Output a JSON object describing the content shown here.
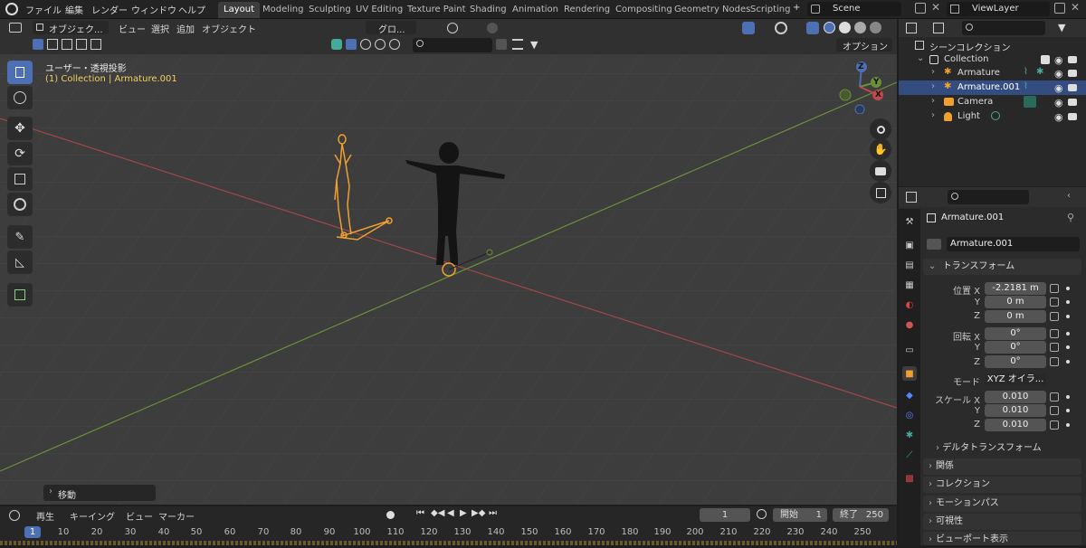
{
  "topbar": {
    "menus": [
      "ファイル",
      "編集",
      "レンダー",
      "ウィンドウ",
      "ヘルプ"
    ],
    "workspaces": [
      "Layout",
      "Modeling",
      "Sculpting",
      "UV Editing",
      "Texture Paint",
      "Shading",
      "Animation",
      "Rendering",
      "Compositing",
      "Geometry Nodes",
      "Scripting"
    ],
    "active_workspace": "Layout",
    "add_tab": "+",
    "scene": "Scene",
    "view_layer": "ViewLayer"
  },
  "viewport": {
    "mode": "オブジェク...",
    "menus": [
      "ビュー",
      "選択",
      "追加",
      "オブジェクト"
    ],
    "orientation": "グロ...",
    "options": "オプション",
    "overlay_title": "ユーザー・透視投影",
    "overlay_subtitle": "(1) Collection | Armature.001",
    "axis_labels": {
      "x": "X",
      "y": "Y",
      "z": "Z"
    },
    "last_op": "移動"
  },
  "outliner": {
    "root": "シーンコレクション",
    "collection": "Collection",
    "items": [
      {
        "name": "Armature",
        "selected": false
      },
      {
        "name": "Armature.001",
        "selected": true
      },
      {
        "name": "Camera",
        "selected": false
      },
      {
        "name": "Light",
        "selected": false
      }
    ]
  },
  "properties": {
    "object_name": "Armature.001",
    "name_field": "Armature.001",
    "transform": {
      "header": "トランスフォーム",
      "location_label": "位置 X",
      "location": [
        "-2.2181 m",
        "0 m",
        "0 m"
      ],
      "rotation_label": "回転 X",
      "rotation": [
        "0°",
        "0°",
        "0°"
      ],
      "mode_label": "モード",
      "mode": "XYZ オイラ...",
      "scale_label": "スケール X",
      "scale": [
        "0.010",
        "0.010",
        "0.010"
      ],
      "y": "Y",
      "z": "Z",
      "delta": "デルタトランスフォーム"
    },
    "sections": [
      "関係",
      "コレクション",
      "モーションパス",
      "可視性",
      "ビューポート表示"
    ]
  },
  "timeline": {
    "play": "再生",
    "keying": "キーイング",
    "view": "ビュー",
    "marker": "マーカー",
    "current_frame": "1",
    "start_label": "開始",
    "start": "1",
    "end_label": "終了",
    "end": "250",
    "ticks": [
      "1",
      "10",
      "20",
      "30",
      "40",
      "50",
      "60",
      "70",
      "80",
      "90",
      "100",
      "110",
      "120",
      "130",
      "140",
      "150",
      "160",
      "170",
      "180",
      "190",
      "200",
      "210",
      "220",
      "230",
      "240",
      "250"
    ]
  },
  "colors": {
    "accent": "#4d6fb3",
    "armature": "#f0a030",
    "x_axis": "#a04848",
    "y_axis": "#6a8f3a"
  }
}
